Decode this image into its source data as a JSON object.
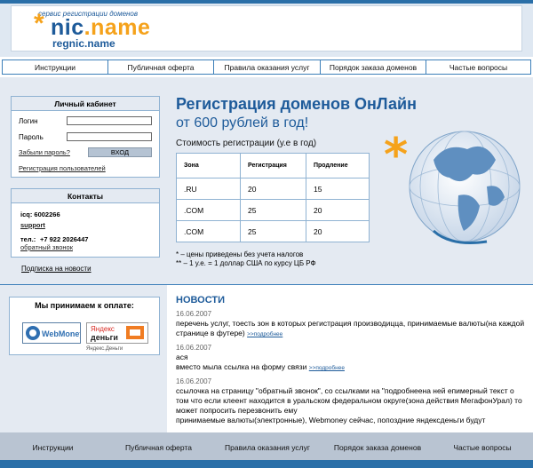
{
  "header": {
    "tagline": "сервис регистрации доменов",
    "logo_nic": "nic",
    "logo_name": ".name",
    "logo_sub": "regnic.name"
  },
  "nav": {
    "items": [
      "Инструкции",
      "Публичная оферта",
      "Правила оказания услуг",
      "Порядок заказа доменов",
      "Частые вопросы"
    ]
  },
  "login": {
    "title": "Личный кабинет",
    "login_label": "Логин",
    "login_value": "",
    "password_label": "Пароль",
    "password_value": "",
    "forgot": "Забыли пароль?",
    "submit": "ВХОД",
    "register": "Регистрация пользователей"
  },
  "contacts": {
    "title": "Контакты",
    "icq": "icq: 6002266",
    "support": "support",
    "phone_label": "тел.:",
    "phone": "+7 922 2026447",
    "callback": "обратный звонок"
  },
  "subscribe": "Подписка на новости",
  "main": {
    "title": "Регистрация доменов ОнЛайн",
    "subtitle": "от 600 рублей в год!",
    "cost_label": "Стоимость регистрации (у.е в год)",
    "table_headers": [
      "Зона",
      "Регистрация",
      "Продление"
    ],
    "table_rows": [
      [
        ".RU",
        "20",
        "15"
      ],
      [
        ".COM",
        "25",
        "20"
      ],
      [
        ".COM",
        "25",
        "20"
      ]
    ],
    "note1": "* – цены приведены без учета налогов",
    "note2": "** – 1 у.е. = 1 доллар США по курсу ЦБ РФ"
  },
  "payment": {
    "title": "Мы принимаем к оплате:",
    "webmoney": "WebMoney",
    "yandex_line1": "Яндекс",
    "yandex_line2": "деньги",
    "yandex_caption": "Яндекс.Деньги"
  },
  "news": {
    "title": "НОВОСТИ",
    "more": ">>подробнее",
    "items": [
      {
        "date": "16.06.2007",
        "text": "перечень услуг, тоесть зон в которых регистрация производицца, принимаемые валюты(на каждой странице в футере)"
      },
      {
        "date": "16.06.2007",
        "text": "ася",
        "text2": "вместо мыла ссылка на форму связи"
      },
      {
        "date": "16.06.2007",
        "text": "ссылочка на страницу \"обратный звонок\", со ссылками на \"подробнеена ней епимерный текст о том что если клеент находится в уральском федеральном округе(зона действия МегафонУрал) то может попросить перезвонить ему",
        "text2": "принимаемые валюты(электронные), Webmoney сейчас, попоздние яндексденьги будут"
      }
    ]
  },
  "colors": {
    "brand_blue": "#1e5b9a",
    "accent_orange": "#f5a21b",
    "band": "#e4eaf2"
  }
}
